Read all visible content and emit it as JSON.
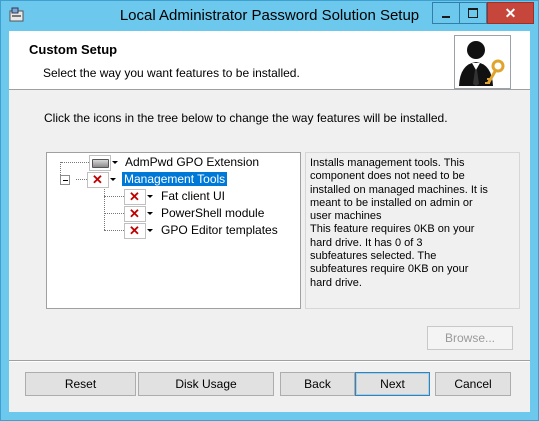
{
  "window": {
    "title": "Local Administrator Password Solution Setup"
  },
  "header": {
    "title": "Custom Setup",
    "subtitle": "Select the way you want features to be installed."
  },
  "instruction": "Click the icons in the tree below to change the way features will be installed.",
  "tree": {
    "items": [
      {
        "label": "AdmPwd GPO Extension",
        "state": "install"
      },
      {
        "label": "Management Tools",
        "state": "not-installed",
        "selected": true
      },
      {
        "label": "Fat client UI",
        "state": "not-installed"
      },
      {
        "label": "PowerShell module",
        "state": "not-installed"
      },
      {
        "label": "GPO Editor templates",
        "state": "not-installed"
      }
    ]
  },
  "description": {
    "lines": [
      "Installs management tools. This",
      "component does not need to be",
      "installed on managed machines. It is",
      "meant to be installed on admin or",
      "user machines",
      "This feature requires 0KB on your",
      "hard drive. It has 0 of 3",
      "subfeatures selected. The",
      "subfeatures require 0KB on your",
      "hard drive."
    ]
  },
  "buttons": {
    "browse": "Browse...",
    "reset": "Reset",
    "disk_usage": "Disk Usage",
    "back": "Back",
    "next": "Next",
    "cancel": "Cancel"
  },
  "colors": {
    "title_bar": "#6cc8ec",
    "close_button": "#c7463c",
    "selection": "#0078d7",
    "not_installed_x": "#c00000"
  },
  "icons": {
    "app": "installer-icon",
    "header": "user-key-icon",
    "minimize": "minimize-icon",
    "maximize": "maximize-icon",
    "close": "close-icon"
  }
}
